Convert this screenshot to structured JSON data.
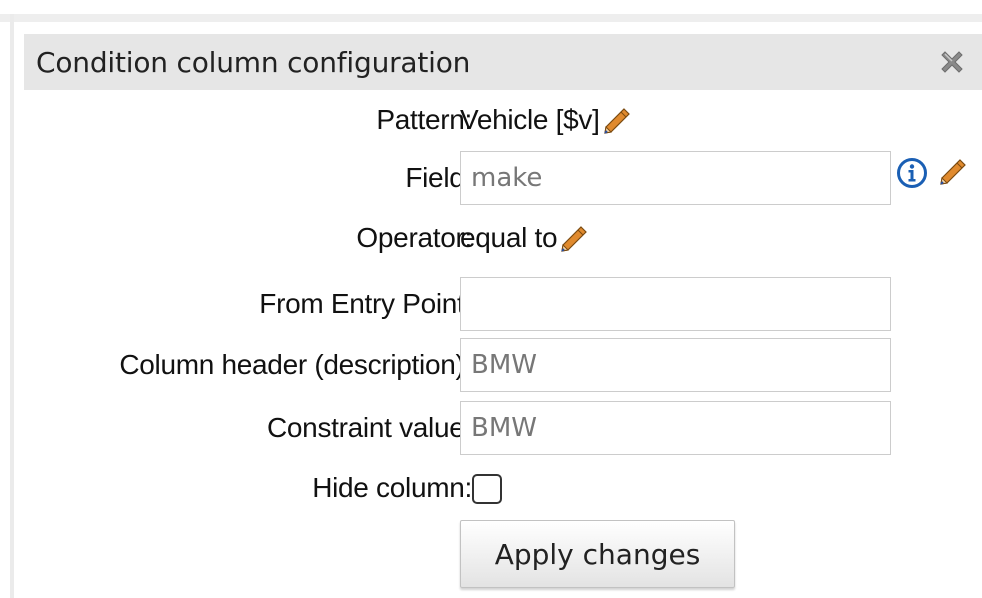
{
  "dialog": {
    "title": "Condition column configuration",
    "close_icon": "close-x-icon"
  },
  "pattern": {
    "label": "Pattern:",
    "value": "Vehicle [$v]",
    "icon": "pencil-icon"
  },
  "field": {
    "label": "Field:",
    "value": "make",
    "icons": [
      "info-icon",
      "pencil-icon"
    ]
  },
  "operator": {
    "label": "Operator:",
    "value": "equal to",
    "icon": "pencil-icon"
  },
  "entry_point": {
    "label": "From Entry Point:",
    "value": ""
  },
  "column_header": {
    "label": "Column header (description):",
    "value": "BMW"
  },
  "constraint": {
    "label": "Constraint value:",
    "value": "BMW"
  },
  "hide_column": {
    "label": "Hide column:",
    "checked": false
  },
  "apply_label": "Apply changes",
  "colors": {
    "titlebar": "#e6e6e6",
    "info": "#1a5fb4",
    "pencil": "#e08a2e"
  }
}
